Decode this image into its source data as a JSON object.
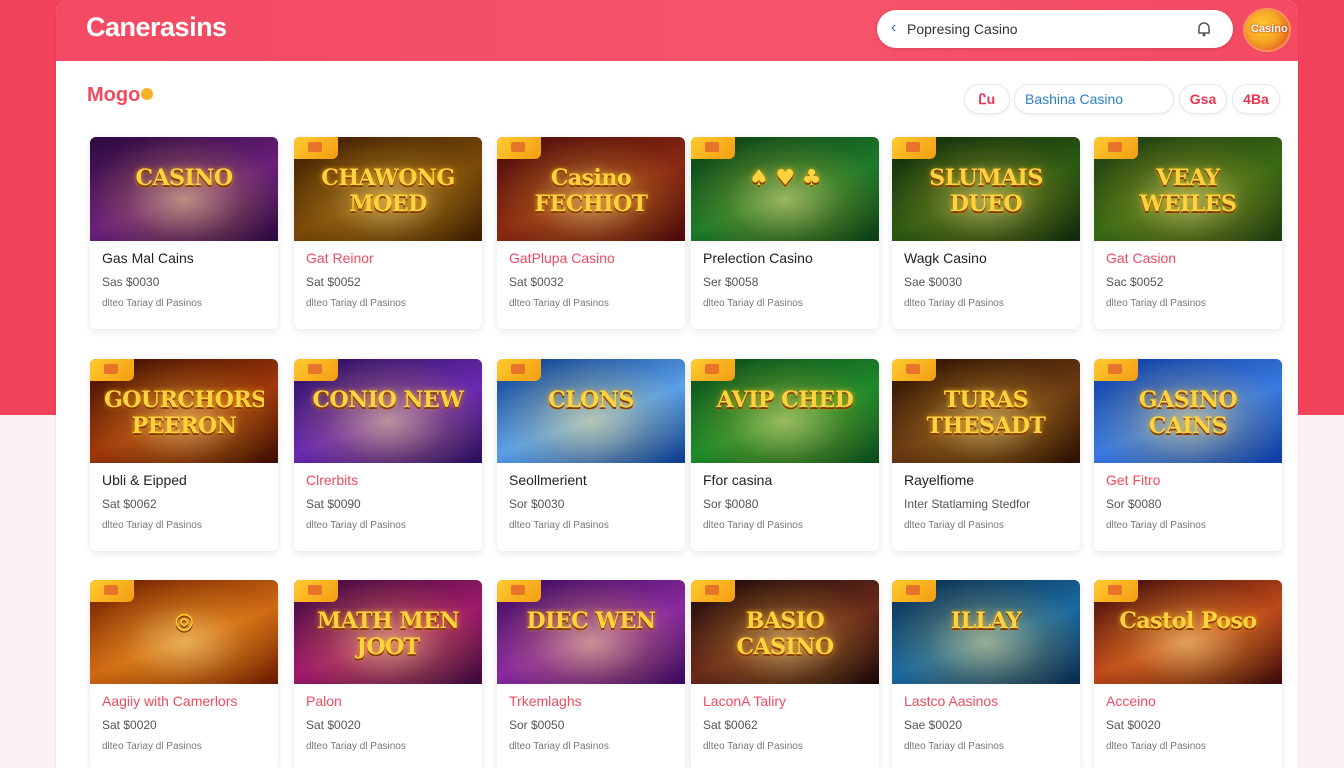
{
  "header": {
    "brand": "Canerasins",
    "search_text": "Popresing Casino",
    "avatar_label": "Casino"
  },
  "section": {
    "title": "Mogo"
  },
  "filters": {
    "f1": "Ꮭu",
    "f2": "Bashina Casino",
    "f3": "Gsa",
    "f4": "4Ba"
  },
  "icons": {
    "back": "chevron-left-icon",
    "search_right": "notification-icon",
    "avatar": "casino-avatar-icon"
  },
  "cards": [
    {
      "name": "Gas Mal Cains",
      "name_red": false,
      "meta": "Sas $0030",
      "sub": "dlteo Tariay dl Pasinos",
      "art": "CASINO",
      "theme": "purple"
    },
    {
      "name": "Gat Reinor",
      "name_red": true,
      "meta": "Sat $0052",
      "sub": "dlteo Tariay dl Pasinos",
      "art": "CHAWONG MOED",
      "theme": "gold"
    },
    {
      "name": "GatPlupa Casino",
      "name_red": true,
      "meta": "Sat $0032",
      "sub": "dlteo Tariay dl Pasinos",
      "art": "Casino FECHIOT",
      "theme": "red"
    },
    {
      "name": "Prelection Casino",
      "name_red": false,
      "meta": "Ser $0058",
      "sub": "dlteo Tariay dl Pasinos",
      "art": "♠ ♥ ♣",
      "theme": "green"
    },
    {
      "name": "Wagk Casino",
      "name_red": false,
      "meta": "Sae $0030",
      "sub": "dlteo Tariay dl Pasinos",
      "art": "SLUMAIS DUEO",
      "theme": "darkgreen"
    },
    {
      "name": "Gat Casion",
      "name_red": true,
      "meta": "Sac $0052",
      "sub": "dlteo Tariay dl Pasinos",
      "art": "VEAY WEILES",
      "theme": "forest"
    },
    {
      "name": "Ubli & Eipped",
      "name_red": false,
      "meta": "Sat $0062",
      "sub": "dlteo Tariay dl Pasinos",
      "art": "GOURCHORS PEERON",
      "theme": "ember"
    },
    {
      "name": "Clrerbits",
      "name_red": true,
      "meta": "Sat $0090",
      "sub": "dlteo Tariay dl Pasinos",
      "art": "CONIO NEW",
      "theme": "violet"
    },
    {
      "name": "Seollmerient",
      "name_red": false,
      "meta": "Sor $0030",
      "sub": "dlteo Tariay dl Pasinos",
      "art": "CLONS",
      "theme": "blue"
    },
    {
      "name": "Ffor casina",
      "name_red": false,
      "meta": "Sor $0080",
      "sub": "dlteo Tariay dl Pasinos",
      "art": "AVIP CHED",
      "theme": "emerald"
    },
    {
      "name": "Rayelfiome",
      "name_red": false,
      "meta": "Inter Statlaming Stedfor",
      "sub": "dlteo Tariay dl Pasinos",
      "art": "TURAS THESADT",
      "theme": "bronze"
    },
    {
      "name": "Get Fitro",
      "name_red": true,
      "meta": "Sor $0080",
      "sub": "dlteo Tariay dl Pasinos",
      "art": "GASINO CAINS",
      "theme": "sky"
    },
    {
      "name": "Aagiiy with Camerlors",
      "name_red": true,
      "meta": "Sat $0020",
      "sub": "dlteo Tariay dl Pasinos",
      "art": "◎",
      "theme": "orange"
    },
    {
      "name": "Palon",
      "name_red": true,
      "meta": "Sat $0020",
      "sub": "dlteo Tariay dl Pasinos",
      "art": "MATH MEN JOOT",
      "theme": "magenta"
    },
    {
      "name": "Trkemlaghs",
      "name_red": true,
      "meta": "Sor $0050",
      "sub": "dlteo Tariay dl Pasinos",
      "art": "DIEC WEN",
      "theme": "plum"
    },
    {
      "name": "LaconA Taliry",
      "name_red": true,
      "meta": "Sat $0062",
      "sub": "dlteo Tariay dl Pasinos",
      "art": "BASIO CASINO",
      "theme": "night"
    },
    {
      "name": "Lastco Aasinos",
      "name_red": true,
      "meta": "Sae $0020",
      "sub": "dlteo Tariay dl Pasinos",
      "art": "ILLAY",
      "theme": "teal"
    },
    {
      "name": "Acceino",
      "name_red": true,
      "meta": "Sat $0020",
      "sub": "dlteo Tariay dl Pasinos",
      "art": "Castol Poso",
      "theme": "sunset"
    }
  ],
  "themes": {
    "purple": [
      "#2b0a3d",
      "#6a1f7a"
    ],
    "gold": [
      "#3a1c00",
      "#7a4a08"
    ],
    "red": [
      "#4a0a0a",
      "#8a2a12"
    ],
    "green": [
      "#0b3d14",
      "#1f7a2a"
    ],
    "darkgreen": [
      "#0e2a0c",
      "#2d5a12"
    ],
    "forest": [
      "#1e3a10",
      "#3a6a14"
    ],
    "ember": [
      "#3a0d00",
      "#a0380a"
    ],
    "violet": [
      "#2a0f5a",
      "#6a2ab0"
    ],
    "blue": [
      "#0a3a8a",
      "#5aa0e8"
    ],
    "emerald": [
      "#0a4a1a",
      "#1f8a2a"
    ],
    "bronze": [
      "#2a1000",
      "#6a3a12"
    ],
    "sky": [
      "#0a3aa0",
      "#3a7ae0"
    ],
    "orange": [
      "#6a1a00",
      "#d06a12"
    ],
    "magenta": [
      "#3a0a3a",
      "#a01a6a"
    ],
    "plum": [
      "#3a0a5a",
      "#8a2aa0"
    ],
    "night": [
      "#1a0a0a",
      "#6a2a1a"
    ],
    "teal": [
      "#0a2a4a",
      "#1a6aa0"
    ],
    "sunset": [
      "#3a0a0a",
      "#c04a1a"
    ]
  }
}
